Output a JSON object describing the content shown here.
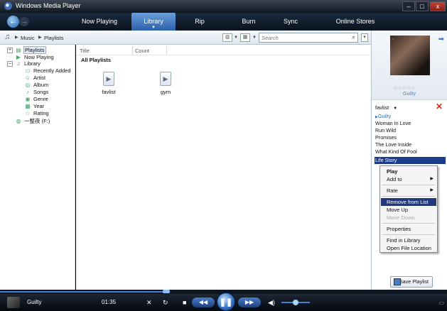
{
  "window": {
    "title": "Windows Media Player"
  },
  "nav": {
    "tabs": [
      "Now Playing",
      "Library",
      "Rip",
      "Burn",
      "Sync",
      "Online Stores"
    ],
    "active_tab": "Library"
  },
  "toolbar": {
    "breadcrumb": [
      "Music",
      "Playlists"
    ],
    "search_placeholder": "Search"
  },
  "tree": {
    "items": [
      {
        "label": "Playlists",
        "selected": true
      },
      {
        "label": "Now Playing"
      },
      {
        "label": "Library"
      },
      {
        "label": "Recently Added"
      },
      {
        "label": "Artist"
      },
      {
        "label": "Album"
      },
      {
        "label": "Songs"
      },
      {
        "label": "Genre"
      },
      {
        "label": "Year"
      },
      {
        "label": "Rating"
      },
      {
        "label": "一整夜 (F:)"
      }
    ]
  },
  "main": {
    "columns": [
      "Title",
      "Count"
    ],
    "section_title": "All Playlists",
    "playlists": [
      "favlist",
      "gym"
    ]
  },
  "rightpane": {
    "album_title": "Guilty",
    "rating_stars": "☆☆☆☆☆",
    "list_name": "favlist",
    "tracks": [
      "Guilty",
      "Woman In Love",
      "Run Wild",
      "Promises",
      "The Love Inside",
      "What Kind Of Fool",
      "Life Story"
    ],
    "playing_track": "Guilty",
    "selected_track": "Life Story",
    "save_label": "Save Playlist"
  },
  "context_menu": {
    "items": [
      "Play",
      "Add to",
      "Rate",
      "Remove from List",
      "Move Up",
      "Move Down",
      "Properties",
      "Find in Library",
      "Open File Location"
    ],
    "highlighted": "Remove from List",
    "disabled": [
      "Move Down"
    ]
  },
  "player": {
    "now_playing_title": "Guilty",
    "time": "01:35",
    "state": "playing"
  }
}
